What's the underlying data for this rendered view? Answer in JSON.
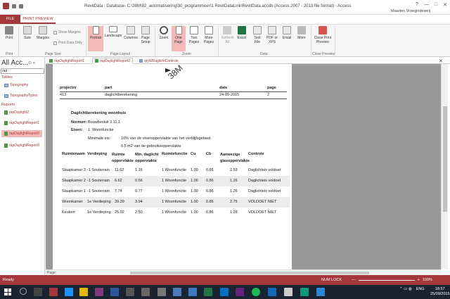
{
  "title_bar": {
    "title": "RevitData : Database- C:\\38M\\02_automatisering\\30_programmeer\\1 RevitDataLink\\RevitData.accdb (Access 2007 - 2013 file format) - Access",
    "user": "Maarten Vroegindeweij",
    "help": "?",
    "minimize": "—",
    "maximize": "□",
    "close": "✕"
  },
  "ribbon_tabs": {
    "file": "FILE",
    "print_preview": "PRINT PREVIEW"
  },
  "ribbon": {
    "print": "Print",
    "size": "Size",
    "margins": "Margins",
    "show_margins": "Show Margins",
    "print_data_only": "Print Data Only",
    "portrait": "Portrait",
    "landscape": "Landscape",
    "columns": "Columns",
    "page_setup": "Page Setup",
    "zoom": "Zoom",
    "one_page": "One Page",
    "two_pages": "Two Pages",
    "more_pages": "More Pages",
    "refresh_all": "Refresh All",
    "excel": "Excel",
    "text_file": "Text File",
    "pdf_xps": "PDF or XPS",
    "email": "Email",
    "more": "More",
    "close_preview": "Close Print Preview",
    "groups": {
      "print": "Print",
      "page_size": "Page Size",
      "page_layout": "Page Layout",
      "zoom": "Zoom",
      "data": "Data",
      "close_preview": "Close Preview"
    }
  },
  "nav_pane": {
    "header": "All Acc...",
    "search_value": "rap",
    "sections": [
      {
        "label": "Tables",
        "items": [
          "Topography",
          "TopographyTypes"
        ]
      },
      {
        "label": "Reports",
        "items": [
          "rapDaylight2",
          "rapDaylightReport1",
          "rapDaylightReport2",
          "rapDaylightReport3"
        ]
      }
    ],
    "selected": "rapDaylightReport2"
  },
  "doc_tabs": [
    "rapDaylightReport1",
    "rapDaylightReport2",
    "qryWDaglichtControle"
  ],
  "report": {
    "logo_text": "38M",
    "header_labels": {
      "project": "projectnr",
      "part": "part",
      "date": "date",
      "page": "page"
    },
    "header_values": {
      "project": "413",
      "part": "daglichtberekening",
      "date": "24-09-2015",
      "page": "2"
    },
    "section_title": "Daglichtberekening woonhuis",
    "norm_label": "Normen:",
    "norm_value": "Bouwbesluit 3.11.1",
    "eisen_label": "Eisen:",
    "eisen_value": "1. Woonfunctie",
    "minimale_label": "Minimale eis:",
    "requirement_1": "10% van de vloeroppervlakte van het verblijfsgebied",
    "requirement_2": "0.5 m2 van de gebruiksoppervlakte",
    "columns": [
      "Ruimtenaam",
      "Verdieping",
      "Ruimte oppervlakte",
      "Min. daglicht oppervlakte",
      "Ruimtefunctie",
      "Cu",
      "Cb",
      "Aanwezige glasoppervlakte",
      "Controle"
    ],
    "rows": [
      {
        "name": "Slaapkamer 3",
        "floor": "-1 Souterrain",
        "area": "11.62",
        "min": "1.16",
        "func": "1 Woonfunctie",
        "cu": "1.00",
        "cb": "0.86",
        "glass": "2.53",
        "check": "Daglichteis voldoet"
      },
      {
        "name": "Slaapkamer 2",
        "floor": "-1 Souterrain",
        "area": "6.62",
        "min": "0.66",
        "func": "1 Woonfunctie",
        "cu": "1.00",
        "cb": "0.86",
        "glass": "1.26",
        "check": "Daglichteis voldoet"
      },
      {
        "name": "Slaapkamer 1",
        "floor": "-1 Souterrain",
        "area": "7.74",
        "min": "0.77",
        "func": "1 Woonfunctie",
        "cu": "1.00",
        "cb": "0.86",
        "glass": "1.26",
        "check": "Daglichteis voldoet"
      },
      {
        "name": "Woonkamer",
        "floor": "1e Verdieping",
        "area": "39.39",
        "min": "3.94",
        "func": "1 Woonfunctie",
        "cu": "1.00",
        "cb": "0.86",
        "glass": "2.75",
        "check": "VOLDOET NIET"
      },
      {
        "name": "Keuken",
        "floor": "1e Verdieping",
        "area": "25.02",
        "min": "2.50",
        "func": "1 Woonfunctie",
        "cu": "1.00",
        "cb": "0.86",
        "glass": "1.28",
        "check": "VOLDOET NIET"
      }
    ]
  },
  "statusbar": {
    "ready": "Ready",
    "numlock": "NUM LOCK",
    "zoom_minus": "—",
    "zoom_plus": "+",
    "zoom_value": "100%"
  },
  "page_nav": {
    "label": "Page:"
  },
  "taskbar": {
    "lang": "ENG",
    "time": "18:57",
    "date": "25/09/2015"
  },
  "colors": {
    "accent": "#a4373a",
    "selected": "#f4b9b9",
    "taskbar": "#1a2330"
  }
}
